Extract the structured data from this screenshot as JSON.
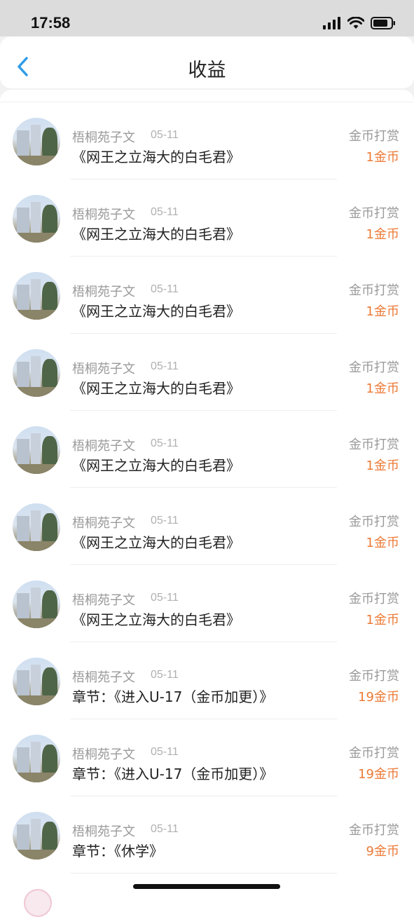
{
  "status_bar": {
    "time": "17:58"
  },
  "header": {
    "title": "收益"
  },
  "colors": {
    "accent_blue": "#2f9ce8",
    "amount_orange": "#ec7a36"
  },
  "rows": [
    {
      "user": "梧桐苑子文",
      "date": "05-11",
      "title": "《网王之立海大的白毛君》",
      "type": "金币打赏",
      "amount": "1金币"
    },
    {
      "user": "梧桐苑子文",
      "date": "05-11",
      "title": "《网王之立海大的白毛君》",
      "type": "金币打赏",
      "amount": "1金币"
    },
    {
      "user": "梧桐苑子文",
      "date": "05-11",
      "title": "《网王之立海大的白毛君》",
      "type": "金币打赏",
      "amount": "1金币"
    },
    {
      "user": "梧桐苑子文",
      "date": "05-11",
      "title": "《网王之立海大的白毛君》",
      "type": "金币打赏",
      "amount": "1金币"
    },
    {
      "user": "梧桐苑子文",
      "date": "05-11",
      "title": "《网王之立海大的白毛君》",
      "type": "金币打赏",
      "amount": "1金币"
    },
    {
      "user": "梧桐苑子文",
      "date": "05-11",
      "title": "《网王之立海大的白毛君》",
      "type": "金币打赏",
      "amount": "1金币"
    },
    {
      "user": "梧桐苑子文",
      "date": "05-11",
      "title": "《网王之立海大的白毛君》",
      "type": "金币打赏",
      "amount": "1金币"
    },
    {
      "user": "梧桐苑子文",
      "date": "05-11",
      "title": "章节：《进入U-17（金币加更）》",
      "type": "金币打赏",
      "amount": "19金币"
    },
    {
      "user": "梧桐苑子文",
      "date": "05-11",
      "title": "章节：《进入U-17（金币加更）》",
      "type": "金币打赏",
      "amount": "19金币"
    },
    {
      "user": "梧桐苑子文",
      "date": "05-11",
      "title": "章节：《休学》",
      "type": "金币打赏",
      "amount": "9金币"
    }
  ]
}
